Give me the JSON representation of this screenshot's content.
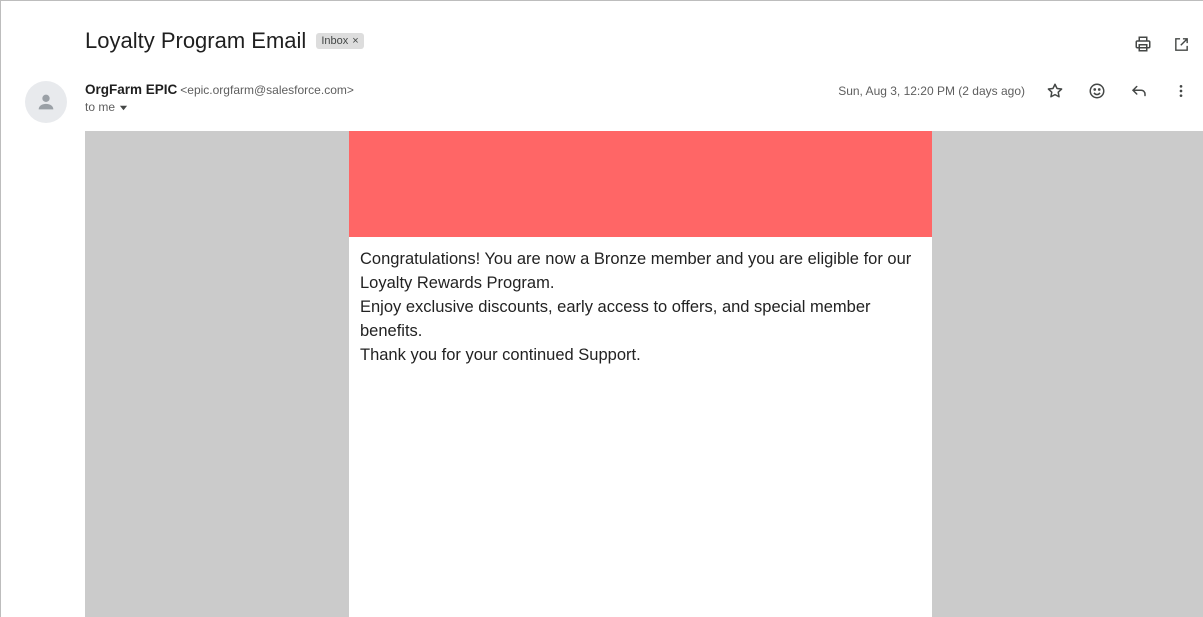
{
  "email": {
    "subject": "Loyalty Program Email",
    "label": "Inbox",
    "label_close": "×",
    "sender_name": "OrgFarm EPIC",
    "sender_email": "<epic.orgfarm@salesforce.com>",
    "to_line": "to me",
    "date": "Sun, Aug 3, 12:20 PM (2 days ago)"
  },
  "icons": {
    "print": "print-icon",
    "open_new": "open-in-new-window-icon",
    "star": "star-icon",
    "emoji": "emoji-icon",
    "reply": "reply-icon",
    "more": "more-vertical-icon",
    "avatar": "person-icon",
    "dropdown": "caret-down-icon"
  },
  "colors": {
    "banner": "#ff6666",
    "body_background": "#cbcbcb",
    "card_background": "#ffffff"
  },
  "message": {
    "line1": "Congratulations! You are now a Bronze member and you are eligible for our Loyalty Rewards Program.",
    "line2": "Enjoy exclusive discounts, early access to offers, and special member benefits.",
    "line3": "Thank you for your continued Support."
  }
}
